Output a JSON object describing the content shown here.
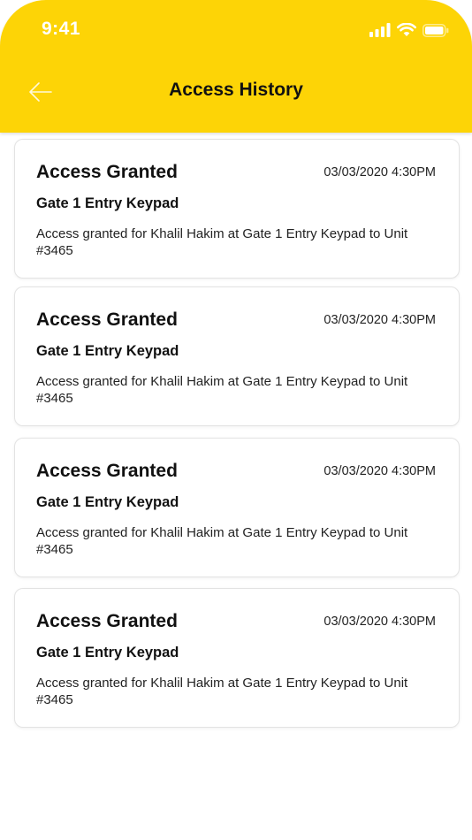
{
  "status_bar": {
    "time": "9:41",
    "icons": [
      "cellular-signal-icon",
      "wifi-icon",
      "battery-icon"
    ]
  },
  "header": {
    "title": "Access History",
    "back_icon": "arrow-left-icon",
    "background_color": "#FDD406"
  },
  "entries": [
    {
      "title": "Access Granted",
      "timestamp": "03/03/2020 4:30PM",
      "device": "Gate 1 Entry Keypad",
      "description": "Access granted for Khalil Hakim at Gate 1 Entry Keypad to Unit #3465"
    },
    {
      "title": "Access Granted",
      "timestamp": "03/03/2020 4:30PM",
      "device": "Gate 1 Entry Keypad",
      "description": "Access granted for Khalil Hakim at Gate 1 Entry Keypad to Unit #3465"
    },
    {
      "title": "Access Granted",
      "timestamp": "03/03/2020 4:30PM",
      "device": "Gate 1 Entry Keypad",
      "description": "Access granted for Khalil Hakim at Gate 1 Entry Keypad to Unit #3465"
    },
    {
      "title": "Access Granted",
      "timestamp": "03/03/2020 4:30PM",
      "device": "Gate 1 Entry Keypad",
      "description": "Access granted for Khalil Hakim at Gate 1 Entry Keypad to Unit #3465"
    }
  ]
}
